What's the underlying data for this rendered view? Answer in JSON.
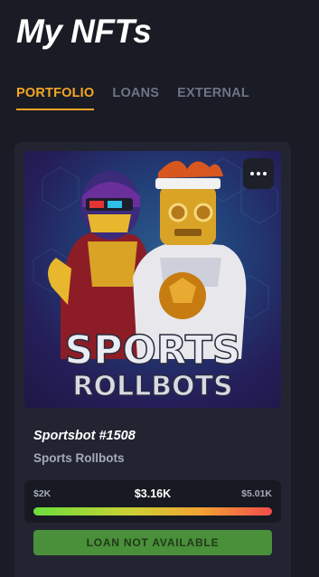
{
  "header": {
    "title": "My NFTs"
  },
  "tabs": [
    {
      "label": "PORTFOLIO",
      "active": true
    },
    {
      "label": "LOANS",
      "active": false
    },
    {
      "label": "EXTERNAL",
      "active": false
    }
  ],
  "card": {
    "image": {
      "artwork_text_line1": "SPORTS",
      "artwork_text_line2": "ROLLBOTS"
    },
    "menu_icon": "more-horizontal-icon",
    "name": "Sportsbot #1508",
    "collection": "Sports Rollbots",
    "price_range": {
      "low": "$2K",
      "current": "$3.16K",
      "high": "$5.01K"
    },
    "loan_button_label": "LOAN NOT AVAILABLE"
  },
  "colors": {
    "background": "#191c25",
    "card": "#222531",
    "accent": "#f5a623",
    "loan_button": "#4a8f3a"
  }
}
